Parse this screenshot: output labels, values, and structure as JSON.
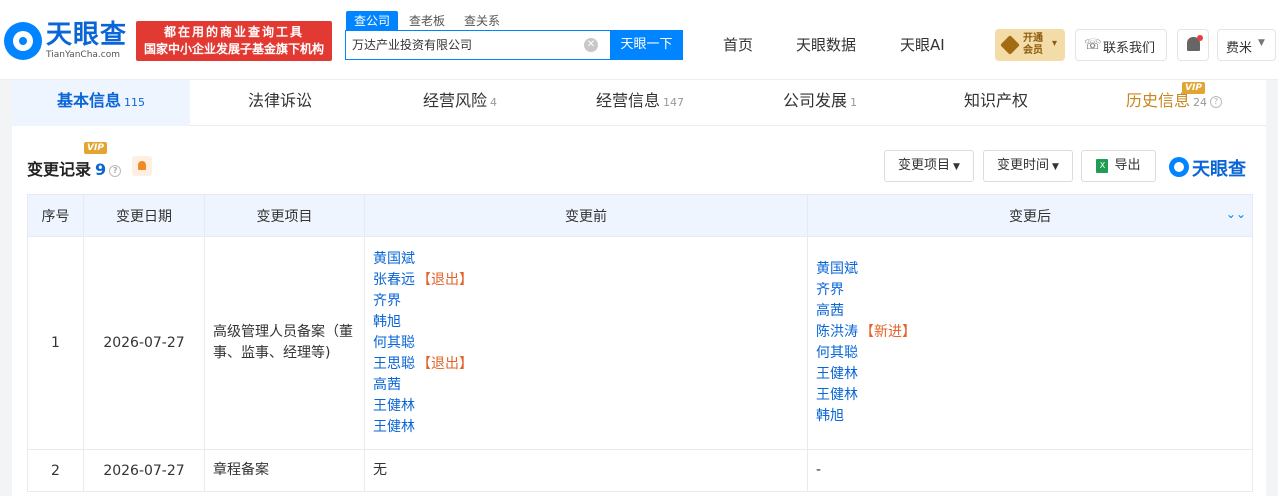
{
  "header": {
    "logo_text": "天眼查",
    "logo_sub": "TianYanCha.com",
    "slogan_line1": "都在用的商业查询工具",
    "slogan_line2": "国家中小企业发展子基金旗下机构",
    "search_tabs": [
      "查公司",
      "查老板",
      "查关系"
    ],
    "search_value": "万达产业投资有限公司",
    "search_button": "天眼一下",
    "nav": [
      "首页",
      "天眼数据",
      "天眼AI"
    ],
    "vip_label": "开通会员",
    "contact_label": "联系我们",
    "user_name": "费米"
  },
  "tabs": [
    {
      "label": "基本信息",
      "count": "115",
      "active": true
    },
    {
      "label": "法律诉讼",
      "count": ""
    },
    {
      "label": "经营风险",
      "count": "4"
    },
    {
      "label": "经营信息",
      "count": "147"
    },
    {
      "label": "公司发展",
      "count": "1"
    },
    {
      "label": "知识产权",
      "count": ""
    },
    {
      "label": "历史信息",
      "count": "24",
      "vip": "VIP"
    }
  ],
  "section": {
    "title": "变更记录",
    "count": "9",
    "vip": "VIP",
    "filter_item": "变更项目",
    "filter_time": "变更时间",
    "export": "导出",
    "brand": "天眼查"
  },
  "table": {
    "headers": [
      "序号",
      "变更日期",
      "变更项目",
      "变更前",
      "变更后"
    ],
    "rows": [
      {
        "index": "1",
        "date": "2026-07-27",
        "item": "高级管理人员备案（董事、监事、经理等)",
        "before": [
          {
            "name": "黄国斌",
            "tag": ""
          },
          {
            "name": "张春远",
            "tag": "【退出】"
          },
          {
            "name": "齐界",
            "tag": ""
          },
          {
            "name": "韩旭",
            "tag": ""
          },
          {
            "name": "何其聪",
            "tag": ""
          },
          {
            "name": "王思聪",
            "tag": "【退出】"
          },
          {
            "name": "高茜",
            "tag": ""
          },
          {
            "name": "王健林",
            "tag": ""
          },
          {
            "name": "王健林",
            "tag": ""
          }
        ],
        "after": [
          {
            "name": "黄国斌",
            "tag": ""
          },
          {
            "name": "齐界",
            "tag": ""
          },
          {
            "name": "高茜",
            "tag": ""
          },
          {
            "name": "陈洪涛",
            "tag": "【新进】"
          },
          {
            "name": "何其聪",
            "tag": ""
          },
          {
            "name": "王健林",
            "tag": ""
          },
          {
            "name": "王健林",
            "tag": ""
          },
          {
            "name": "韩旭",
            "tag": ""
          }
        ]
      },
      {
        "index": "2",
        "date": "2026-07-27",
        "item": "章程备案",
        "before_text": "无",
        "after_text": "-"
      }
    ]
  },
  "colors": {
    "brand_blue": "#0084ff",
    "link_blue": "#0a66d6",
    "tag_orange": "#e4632b",
    "slogan_red": "#e23a33",
    "vip_gold": "#e3a531"
  }
}
